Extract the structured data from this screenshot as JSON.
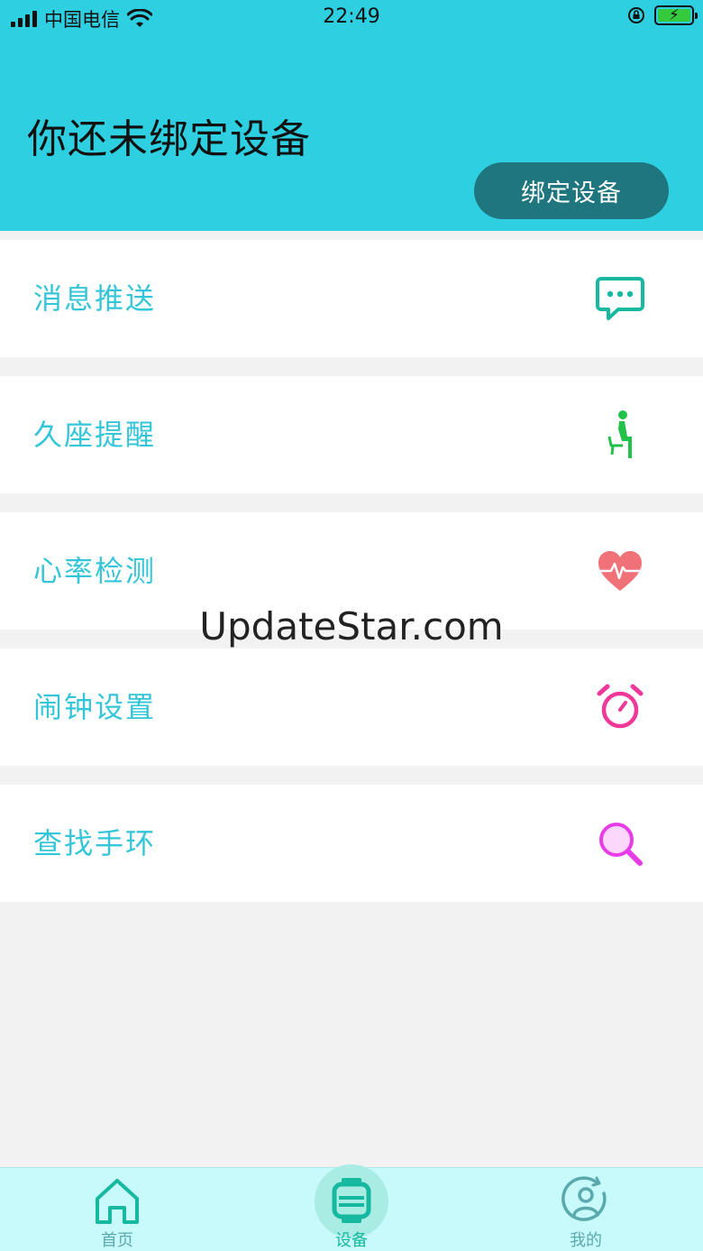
{
  "status_bar": {
    "carrier": "中国电信",
    "time": "22:49",
    "wifi_icon": "wifi-icon",
    "lock_icon": "rotation-lock-icon",
    "battery_icon": "battery-charging-icon",
    "battery_level": 1.0
  },
  "header": {
    "title": "你还未绑定设备",
    "bind_button": "绑定设备"
  },
  "menu": {
    "items": [
      {
        "label": "消息推送",
        "icon": "message-icon",
        "color": "#16b8a0"
      },
      {
        "label": "久座提醒",
        "icon": "sitting-person-icon",
        "color": "#22c24a"
      },
      {
        "label": "心率检测",
        "icon": "heart-rate-icon",
        "color": "#f07178"
      },
      {
        "label": "闹钟设置",
        "icon": "alarm-clock-icon",
        "color": "#f0379a"
      },
      {
        "label": "查找手环",
        "icon": "search-icon",
        "color": "#e83ce8"
      }
    ]
  },
  "watermark": "UpdateStar.com",
  "tabbar": {
    "tabs": [
      {
        "label": "首页",
        "icon": "home-icon"
      },
      {
        "label": "设备",
        "icon": "watch-icon",
        "active": true
      },
      {
        "label": "我的",
        "icon": "profile-icon"
      }
    ]
  },
  "colors": {
    "header_bg": "#2ecfe0",
    "accent_text": "#34c6d8",
    "button_bg": "#1f767f",
    "tabbar_bg": "#c8fafc"
  }
}
